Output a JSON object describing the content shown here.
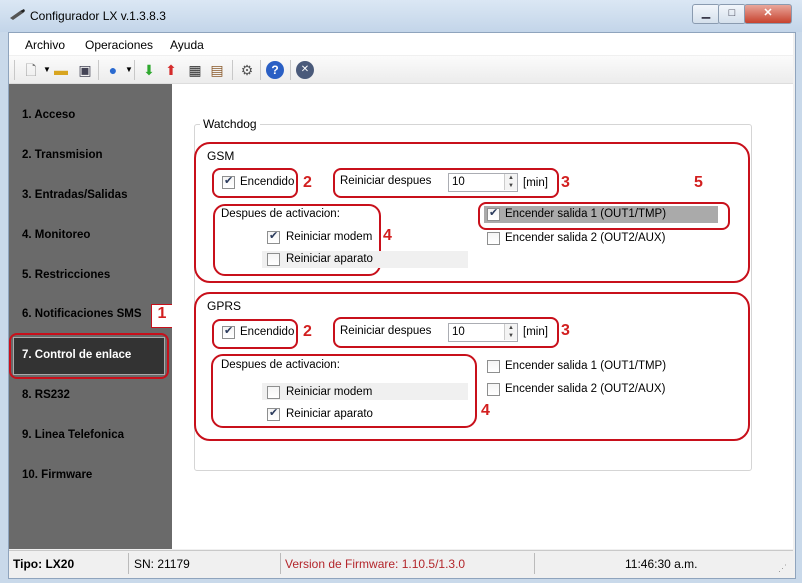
{
  "window": {
    "title": "Configurador LX v.1.3.8.3"
  },
  "menu": [
    "Archivo",
    "Operaciones",
    "Ayuda"
  ],
  "toolbar": {
    "icons": [
      "new-icon",
      "open-folder-icon",
      "save-icon",
      "globe-icon",
      "download-icon",
      "upload-icon",
      "calendar-icon",
      "book-icon",
      "gear-icon",
      "help-icon",
      "disconnect-icon"
    ]
  },
  "sidebar": {
    "items": [
      {
        "label": "1. Acceso"
      },
      {
        "label": "2. Transmision"
      },
      {
        "label": "3. Entradas/Salidas"
      },
      {
        "label": "4. Monitoreo"
      },
      {
        "label": "5. Restricciones"
      },
      {
        "label": "6. Notificaciones SMS"
      },
      {
        "label": "7. Control de enlace"
      },
      {
        "label": "8. RS232"
      },
      {
        "label": "9. Linea Telefonica"
      },
      {
        "label": "10. Firmware"
      }
    ],
    "active_index": 6
  },
  "watchdog": {
    "title": "Watchdog",
    "gsm": {
      "title": "GSM",
      "encendido": {
        "label": "Encendido",
        "checked": true
      },
      "reiniciar_label": "Reiniciar despues",
      "reiniciar_value": "10",
      "unit": "[min]",
      "despues_label": "Despues de activacion:",
      "reiniciar_modem": {
        "label": "Reiniciar modem",
        "checked": true
      },
      "reiniciar_aparato": {
        "label": "Reiniciar aparato",
        "checked": false
      },
      "salida1": {
        "label": "Encender salida 1 (OUT1/TMP)",
        "checked": true
      },
      "salida2": {
        "label": "Encender salida 2 (OUT2/AUX)",
        "checked": false
      }
    },
    "gprs": {
      "title": "GPRS",
      "encendido": {
        "label": "Encendido",
        "checked": true
      },
      "reiniciar_label": "Reiniciar despues",
      "reiniciar_value": "10",
      "unit": "[min]",
      "despues_label": "Despues de activacion:",
      "reiniciar_modem": {
        "label": "Reiniciar modem",
        "checked": false
      },
      "reiniciar_aparato": {
        "label": "Reiniciar aparato",
        "checked": true
      },
      "salida1": {
        "label": "Encender salida 1 (OUT1/TMP)",
        "checked": false
      },
      "salida2": {
        "label": "Encender salida 2 (OUT2/AUX)",
        "checked": false
      }
    }
  },
  "annotations": {
    "n1": "1",
    "n2": "2",
    "n3": "3",
    "n4": "4",
    "n5": "5"
  },
  "status": {
    "tipo": "Tipo: LX20",
    "sn": "SN: 21179",
    "firmware": "Version de Firmware: 1.10.5/1.3.0",
    "time": "11:46:30 a.m."
  },
  "colors": {
    "annotation_red": "#c8101b",
    "sidebar_bg": "#6a6a6a",
    "active_item_bg": "#333333",
    "firmware_text": "#b3262b"
  }
}
